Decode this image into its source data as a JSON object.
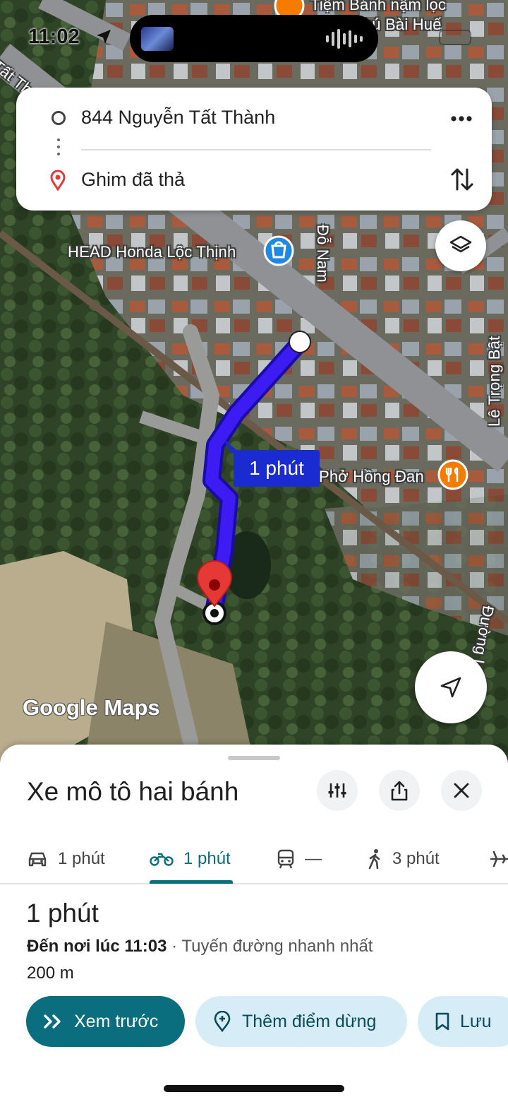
{
  "status_bar": {
    "time": "11:02"
  },
  "route_card": {
    "origin": "844 Nguyễn Tất Thành",
    "destination": "Ghim đã thả"
  },
  "map": {
    "labels": {
      "top_shop": "Tiệm Bánh nậm lọc",
      "top_shop_2": "Phú Bài Huế",
      "street_tat_thanh": "Tất Th",
      "honda": "HEAD Honda Lộc Thịnh",
      "street_do_nam": "Đỗ Nam",
      "street_le_trong_bat": "Lê Trọng Bật",
      "pho": "Phở Hồng Đan",
      "street_duong": "Đường L"
    },
    "eta_bubble": "1 phút",
    "logo": "Google Maps",
    "route_color": "#3c1cf2"
  },
  "sheet": {
    "title": "Xe mô tô hai bánh",
    "tabs": [
      {
        "icon": "car-icon",
        "label": "1 phút"
      },
      {
        "icon": "motorbike-icon",
        "label": "1 phút"
      },
      {
        "icon": "transit-icon",
        "label": "—"
      },
      {
        "icon": "walk-icon",
        "label": "3 phút"
      },
      {
        "icon": "flight-icon",
        "label": ""
      }
    ],
    "duration": "1 phút",
    "arrival_label": "Đến nơi lúc 11:03",
    "route_note": " · Tuyến đường nhanh nhất",
    "distance": "200 m",
    "buttons": {
      "preview": "Xem trước",
      "add_stop": "Thêm điểm dừng",
      "save": "Lưu"
    },
    "accent": "#0b6e7e"
  }
}
